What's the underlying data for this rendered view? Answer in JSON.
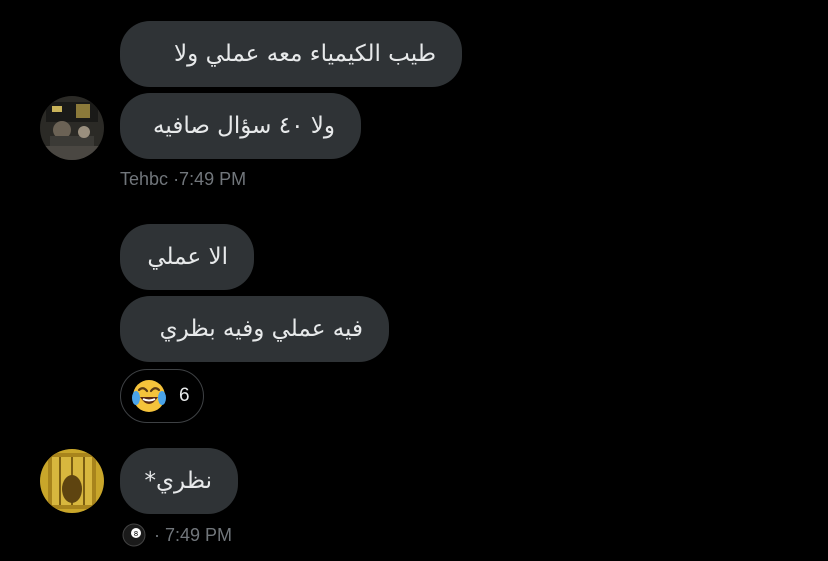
{
  "messages": [
    {
      "text": "طيب الكيمياء معه عملي ولا"
    },
    {
      "text": "ولا ٤٠ سؤال صافيه"
    },
    {
      "text": "الا عملي"
    },
    {
      "text": "فيه عملي وفيه بظري"
    },
    {
      "text": "نظري*"
    }
  ],
  "meta_group1": {
    "sender": "Tehbc",
    "time": "·7:49 PM"
  },
  "meta_group3": {
    "emoji_icon": "8-ball-icon",
    "time": "· 7:49 PM"
  },
  "reaction": {
    "emoji": "face-with-tears-of-joy",
    "count": "6"
  },
  "colors": {
    "background": "#000000",
    "bubble": "#2f3336",
    "text": "#e7e9ea",
    "meta_text": "#71767b"
  }
}
